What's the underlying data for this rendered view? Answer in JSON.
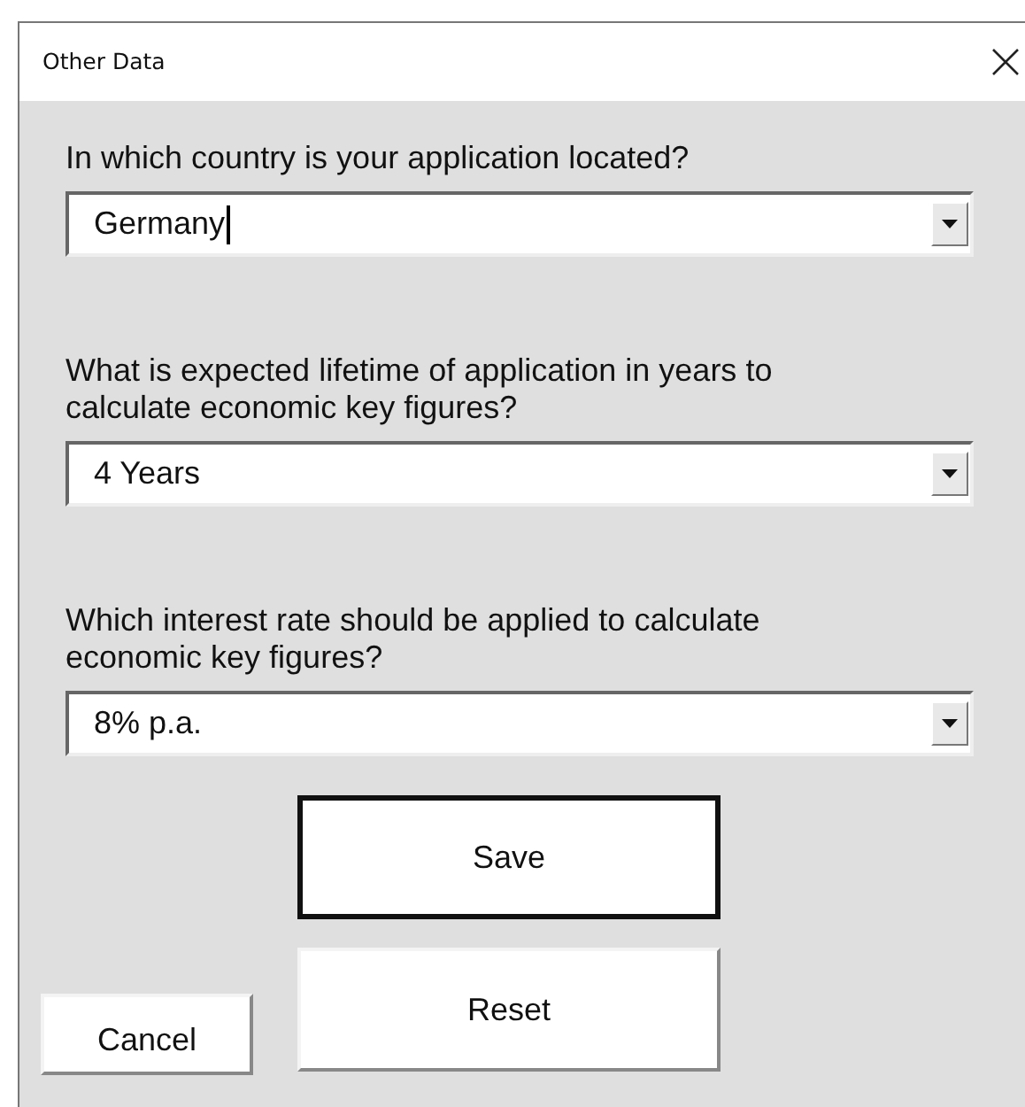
{
  "window": {
    "title": "Other Data"
  },
  "questions": [
    {
      "label": "In which country is your application located?",
      "value": "Germany",
      "focused": true
    },
    {
      "label": "What is expected lifetime of application in years to calculate economic key figures?",
      "value": "4 Years",
      "focused": false
    },
    {
      "label": "Which interest rate should be applied to calculate economic key figures?",
      "value": "8% p.a.",
      "focused": false
    }
  ],
  "buttons": [
    {
      "label": "Save",
      "kind": "main",
      "default": true
    },
    {
      "label": "Reset",
      "kind": "main",
      "default": false
    },
    {
      "label": "Cancel",
      "kind": "side",
      "default": false
    }
  ]
}
